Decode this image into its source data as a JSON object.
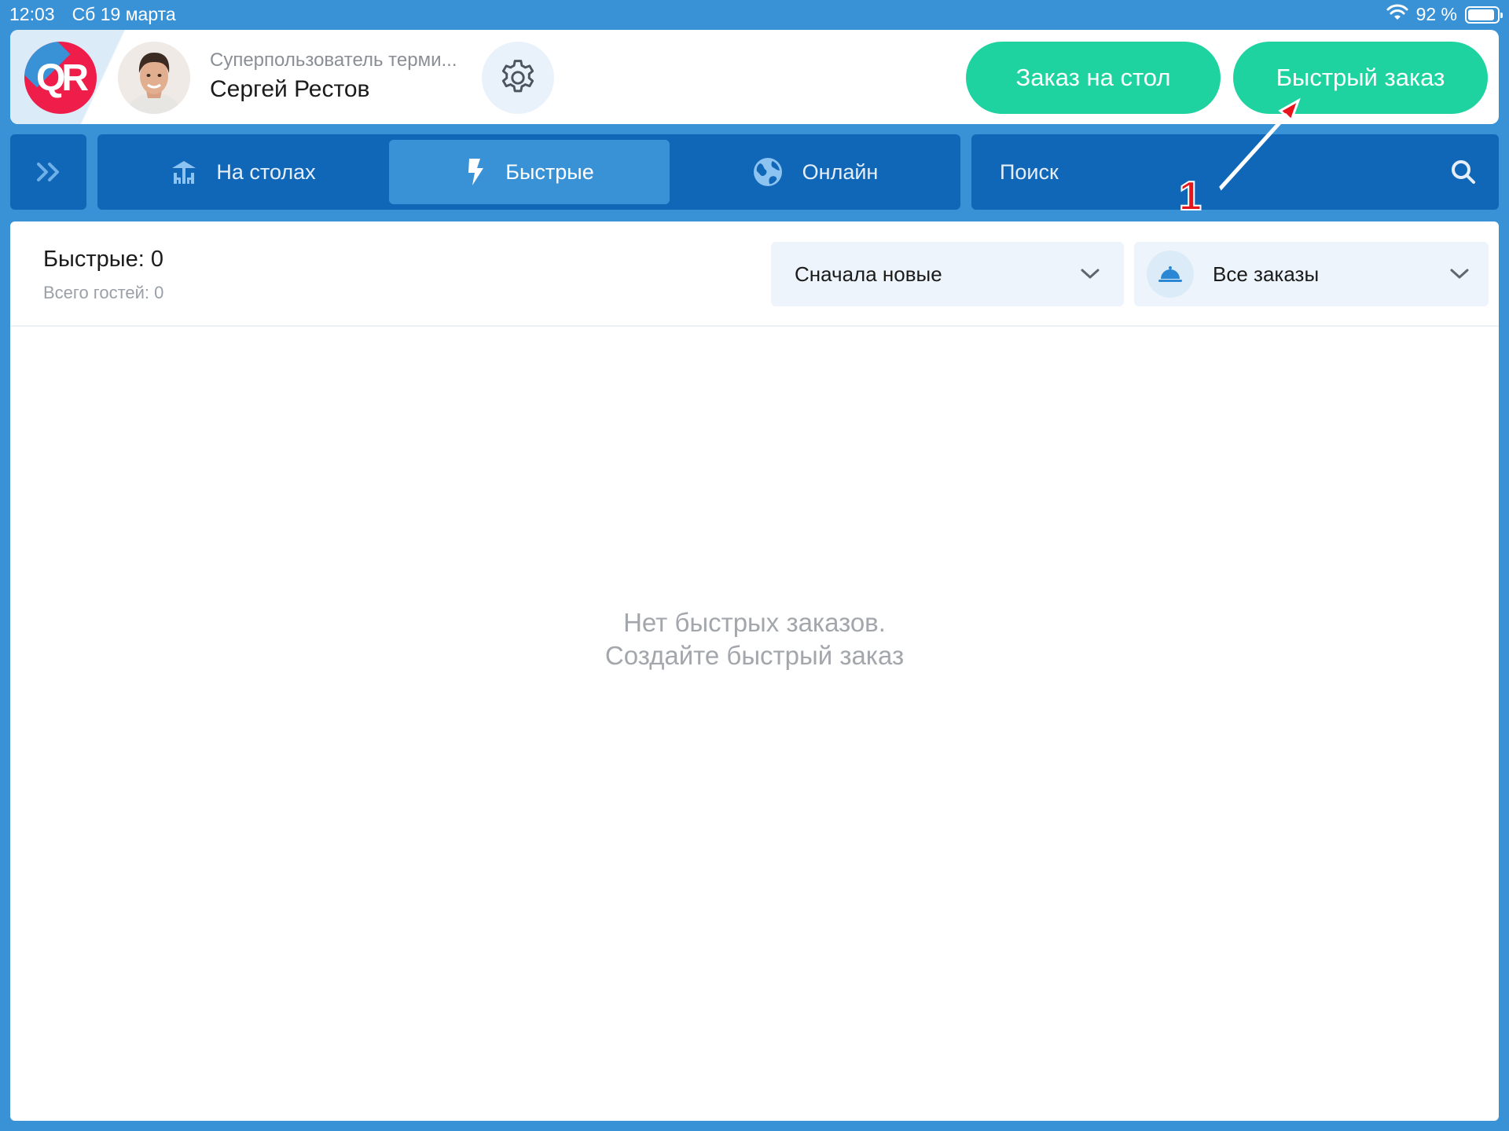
{
  "status_bar": {
    "time": "12:03",
    "date": "Сб 19 марта",
    "battery": "92 %",
    "battery_level": 0.92
  },
  "header": {
    "logo_text": "QR",
    "user_role": "Суперпользователь терми...",
    "user_name": "Сергей Рестов",
    "table_order_label": "Заказ на стол",
    "quick_order_label": "Быстрый заказ"
  },
  "nav": {
    "tabs": [
      {
        "label": "На столах",
        "icon": "tables-icon"
      },
      {
        "label": "Быстрые",
        "icon": "lightning-icon",
        "active": true
      },
      {
        "label": "Онлайн",
        "icon": "globe-icon"
      }
    ],
    "search_placeholder": "Поиск"
  },
  "main": {
    "count_title": "Быстрые: 0",
    "guests": "Всего гостей: 0",
    "sort_value": "Сначала новые",
    "filter_value": "Все заказы",
    "empty_line1": "Нет быстрых заказов.",
    "empty_line2": "Создайте быстрый заказ"
  },
  "annotation": {
    "step": "1"
  },
  "colors": {
    "brand_blue": "#3a92d6",
    "nav_blue": "#1167b7",
    "accent_green": "#1ed3a0",
    "logo_red": "#ee1d49",
    "arrow_red": "#e8141c"
  }
}
